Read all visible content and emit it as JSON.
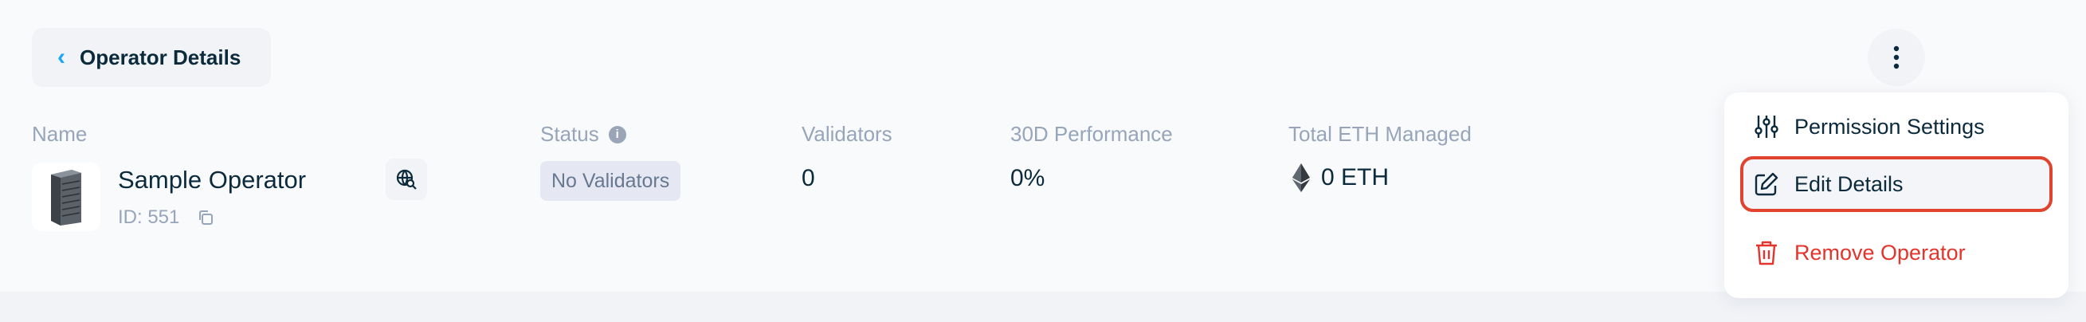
{
  "header": {
    "back_label": "Operator Details",
    "back_icon": "chevron-left-icon",
    "more_icon": "kebab-icon"
  },
  "table": {
    "columns": {
      "name": "Name",
      "status": "Status",
      "validators": "Validators",
      "performance": "30D Performance",
      "total_eth": "Total ETH Managed"
    }
  },
  "operator": {
    "name": "Sample Operator",
    "id": "ID: 551",
    "status": "No Validators",
    "validators": "0",
    "performance": "0%",
    "total_eth": "0 ETH"
  },
  "menu": {
    "items": [
      {
        "label": "Permission Settings",
        "icon": "sliders-icon"
      },
      {
        "label": "Edit Details",
        "icon": "edit-icon"
      },
      {
        "label": "Remove Operator",
        "icon": "trash-icon"
      }
    ]
  },
  "colors": {
    "accent": "#1ba5f8",
    "danger": "#e4342b",
    "highlight": "#e0432e"
  }
}
